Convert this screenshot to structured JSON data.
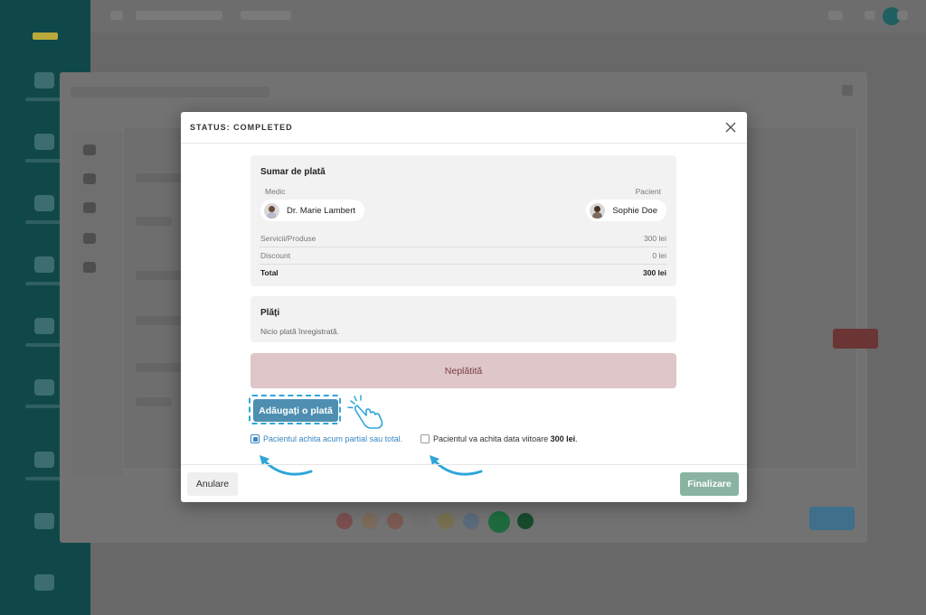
{
  "dialog": {
    "title": "STATUS: COMPLETED",
    "close_icon": "close-icon"
  },
  "summary": {
    "title": "Sumar de plată",
    "medic_label": "Medic",
    "patient_label": "Pacient",
    "medic_name": "Dr. Marie Lambert",
    "patient_name": "Sophie Doe",
    "rows": [
      {
        "label": "Servicii/Produse",
        "value": "300 lei"
      },
      {
        "label": "Discount",
        "value": "0 lei"
      },
      {
        "label": "Total",
        "value": "300 lei"
      }
    ]
  },
  "payments": {
    "title": "Plăți",
    "empty_text": "Nicio plată înregistrată."
  },
  "status_bar": {
    "label": "Neplătită",
    "color": "#dfc6c8"
  },
  "add_payment": {
    "label": "Adăugați o plată",
    "icon": "pointing-hand-icon"
  },
  "options": {
    "now_label": "Pacientul achita acum partial sau total.",
    "now_checked": true,
    "later_prefix": "Pacientul va achita data viitoare ",
    "later_amount": "300 lei",
    "later_suffix": ".",
    "later_checked": false
  },
  "footer": {
    "cancel_label": "Anulare",
    "finish_label": "Finalizare"
  },
  "colors": {
    "accent": "#4e8fb1",
    "highlight": "#2ea6d9",
    "finish": "#8ab4a1",
    "sidebar": "#10484a"
  }
}
